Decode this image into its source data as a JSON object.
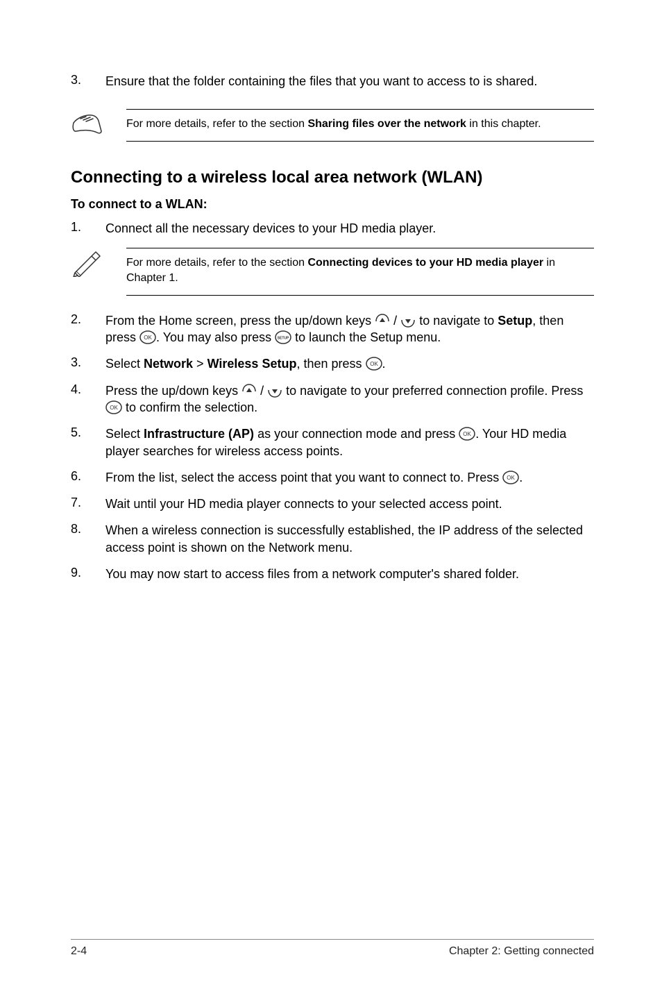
{
  "step3": {
    "num": "3.",
    "text": "Ensure that the folder containing the files that you want to access to is shared."
  },
  "note1": {
    "prefix": "For more details, refer to the section ",
    "bold": "Sharing files over the network",
    "suffix": " in this chapter."
  },
  "heading": "Connecting to a wireless local area network (WLAN)",
  "subheading": "To connect to a WLAN:",
  "steps": {
    "s1": {
      "num": "1.",
      "text": "Connect all the necessary devices to your HD media player."
    },
    "s2": {
      "num": "2.",
      "p1a": "From the Home screen, press the up/down keys ",
      "p1b": " / ",
      "p1c": " to navigate to ",
      "bold1": "Setup",
      "p1d": ", then press ",
      "p1e": ". You may also press ",
      "p1f": " to launch the Setup menu."
    },
    "s3": {
      "num": "3.",
      "a": "Select ",
      "bold1": "Network",
      "sep": " > ",
      "bold2": "Wireless Setup",
      "b": ", then press ",
      "c": "."
    },
    "s4": {
      "num": "4.",
      "a": "Press the up/down keys ",
      "b": " / ",
      "c": " to navigate to your preferred connection profile. Press ",
      "d": " to confirm the selection."
    },
    "s5": {
      "num": "5.",
      "a": "Select ",
      "bold": "Infrastructure (AP)",
      "b": " as your connection mode and press ",
      "c": ". Your HD media player searches for wireless access points."
    },
    "s6": {
      "num": "6.",
      "a": "From the list, select the access point that you want to connect to. Press ",
      "b": "."
    },
    "s7": {
      "num": "7.",
      "text": "Wait until your HD media player connects to your selected access point."
    },
    "s8": {
      "num": "8.",
      "text": "When a wireless connection is successfully established, the IP address of the selected access point is shown on the Network menu."
    },
    "s9": {
      "num": "9.",
      "text": "You may now start to access files from a network computer's shared folder."
    }
  },
  "note2": {
    "prefix": "For more details, refer to the section ",
    "bold": "Connecting devices to your HD media player",
    "suffix": " in Chapter 1."
  },
  "footer": {
    "left": "2-4",
    "right": "Chapter 2:  Getting connected"
  }
}
